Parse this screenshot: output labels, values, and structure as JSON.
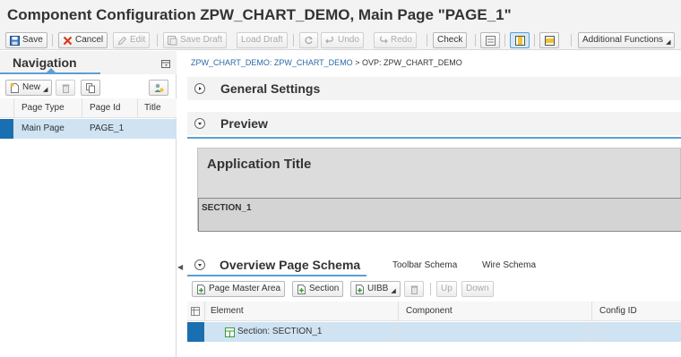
{
  "header": {
    "title": "Component Configuration ZPW_CHART_DEMO, Main Page \"PAGE_1\""
  },
  "toolbar": {
    "save": "Save",
    "cancel": "Cancel",
    "edit": "Edit",
    "save_draft": "Save Draft",
    "load_draft": "Load Draft",
    "undo": "Undo",
    "redo": "Redo",
    "check": "Check",
    "additional_functions": "Additional Functions"
  },
  "navigation": {
    "title": "Navigation",
    "new_label": "New",
    "columns": [
      "Page Type",
      "Page Id",
      "Title"
    ],
    "rows": [
      {
        "page_type": "Main Page",
        "page_id": "PAGE_1",
        "title": ""
      }
    ]
  },
  "breadcrumb": {
    "link": "ZPW_CHART_DEMO: ZPW_CHART_DEMO",
    "separator": " > ",
    "current": "OVP: ZPW_CHART_DEMO"
  },
  "sections": {
    "general": "General Settings",
    "preview": "Preview",
    "schema": "Overview Page Schema"
  },
  "preview": {
    "app_title": "Application Title",
    "section_label": "SECTION_1"
  },
  "schema_tabs": {
    "toolbar_schema": "Toolbar Schema",
    "wire_schema": "Wire Schema"
  },
  "schema_toolbar": {
    "page_master_area": "Page Master Area",
    "section": "Section",
    "uibb": "UIBB",
    "up": "Up",
    "down": "Down"
  },
  "schema_grid": {
    "columns": [
      "Element",
      "Component",
      "Config ID"
    ],
    "rows": [
      {
        "element": "Section: SECTION_1",
        "component": "",
        "config_id": ""
      }
    ]
  },
  "colors": {
    "accent": "#5a9fd4",
    "selected_row": "#cfe3f2",
    "row_marker": "#1a6fb0",
    "link": "#2b6aa8"
  }
}
